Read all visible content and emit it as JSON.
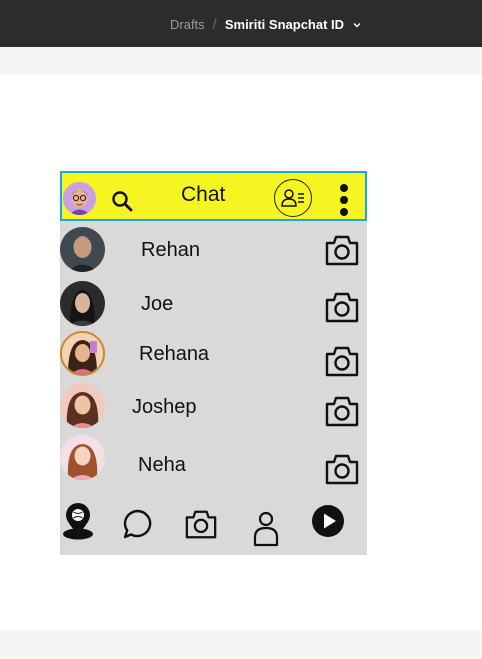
{
  "editor": {
    "breadcrumb_parent": "Drafts",
    "breadcrumb_separator": "/",
    "file_name": "Smiriti Snapchat ID"
  },
  "app": {
    "title": "Chat",
    "header_color": "#f5f522",
    "selection_color": "#1fa3e6",
    "chats": [
      {
        "name": "Rehan"
      },
      {
        "name": "Joe"
      },
      {
        "name": "Rehana"
      },
      {
        "name": "Joshep"
      },
      {
        "name": "Neha"
      }
    ],
    "bottom_nav": [
      "map-pin-icon",
      "chat-bubble-icon",
      "camera-icon",
      "profile-icon",
      "play-icon"
    ]
  }
}
